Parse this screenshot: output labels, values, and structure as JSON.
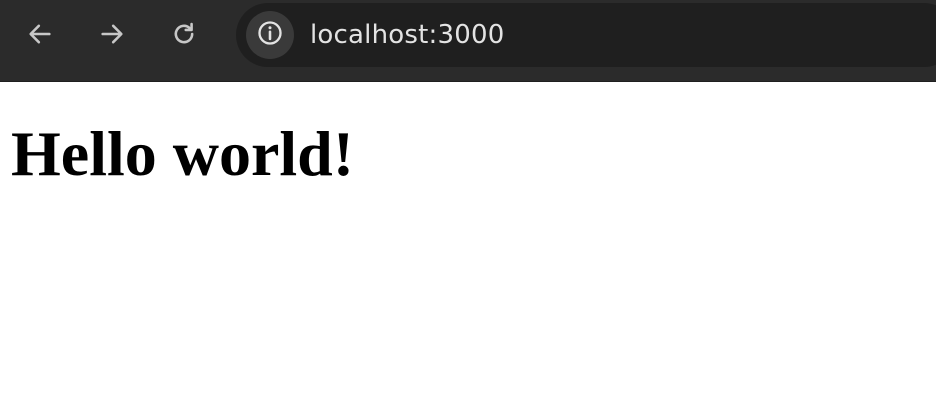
{
  "browser": {
    "address_bar": {
      "url": "localhost:3000"
    },
    "nav": {
      "back_icon": "arrow-left",
      "forward_icon": "arrow-right",
      "reload_icon": "reload",
      "site_info_icon": "info-circle"
    }
  },
  "page": {
    "heading": "Hello world!"
  }
}
